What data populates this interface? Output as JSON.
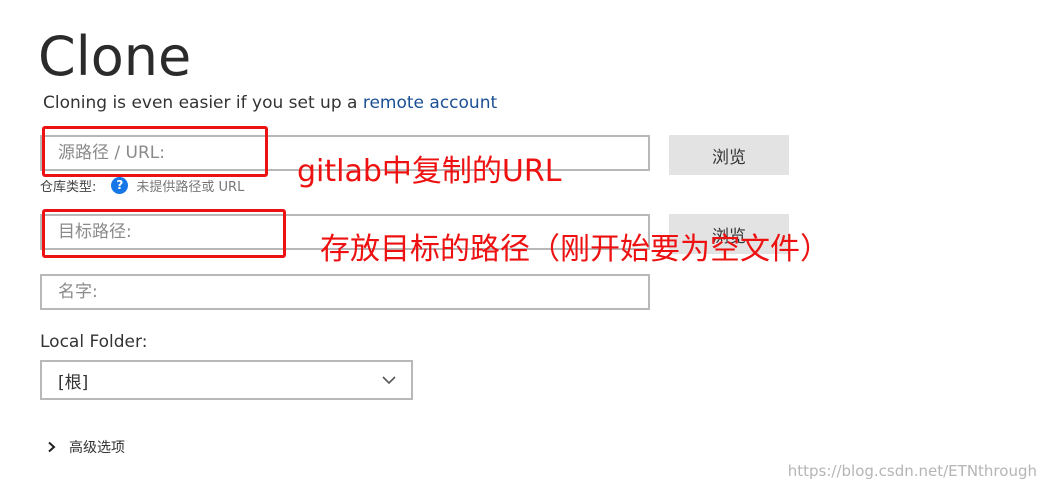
{
  "page": {
    "title": "Clone",
    "subtitle_text": "Cloning is even easier if you set up a ",
    "subtitle_link": "remote account"
  },
  "form": {
    "source_placeholder": "源路径 / URL:",
    "browse_label": "浏览",
    "repo_type_label": "仓库类型:",
    "repo_type_status": "未提供路径或 URL",
    "help_icon": "?",
    "target_placeholder": "目标路径:",
    "name_placeholder": "名字:",
    "local_folder_label": "Local Folder:",
    "local_folder_value": "[根]",
    "advanced_options": "高级选项"
  },
  "annotations": {
    "source_note": "gitlab中复制的URL",
    "target_note": "存放目标的路径（刚开始要为空文件）"
  },
  "watermark": "https://blog.csdn.net/ETNthrough",
  "colors": {
    "annotation_red": "#ee1111",
    "link_blue": "#1a4f94",
    "help_icon_blue": "#1877e6"
  }
}
